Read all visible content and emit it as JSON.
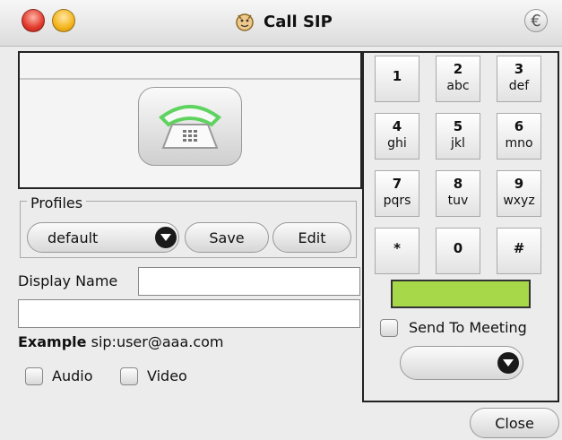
{
  "window": {
    "title": "Call SIP"
  },
  "profiles": {
    "legend": "Profiles",
    "selected": "default",
    "save_label": "Save",
    "edit_label": "Edit"
  },
  "display_name": {
    "label": "Display Name",
    "value": ""
  },
  "address": {
    "value": ""
  },
  "example": {
    "bold": "Example",
    "text": "sip:user@aaa.com"
  },
  "media": {
    "audio_label": "Audio",
    "video_label": "Video"
  },
  "keypad": {
    "keys": [
      {
        "digit": "1",
        "letters": ""
      },
      {
        "digit": "2",
        "letters": "abc"
      },
      {
        "digit": "3",
        "letters": "def"
      },
      {
        "digit": "4",
        "letters": "ghi"
      },
      {
        "digit": "5",
        "letters": "jkl"
      },
      {
        "digit": "6",
        "letters": "mno"
      },
      {
        "digit": "7",
        "letters": "pqrs"
      },
      {
        "digit": "8",
        "letters": "tuv"
      },
      {
        "digit": "9",
        "letters": "wxyz"
      },
      {
        "digit": "*",
        "letters": ""
      },
      {
        "digit": "0",
        "letters": ""
      },
      {
        "digit": "#",
        "letters": ""
      }
    ]
  },
  "meeting": {
    "send_label": "Send To Meeting",
    "selected": ""
  },
  "footer": {
    "close_label": "Close"
  },
  "colors": {
    "status_green": "#a6d84a",
    "window_bg": "#ececec"
  }
}
